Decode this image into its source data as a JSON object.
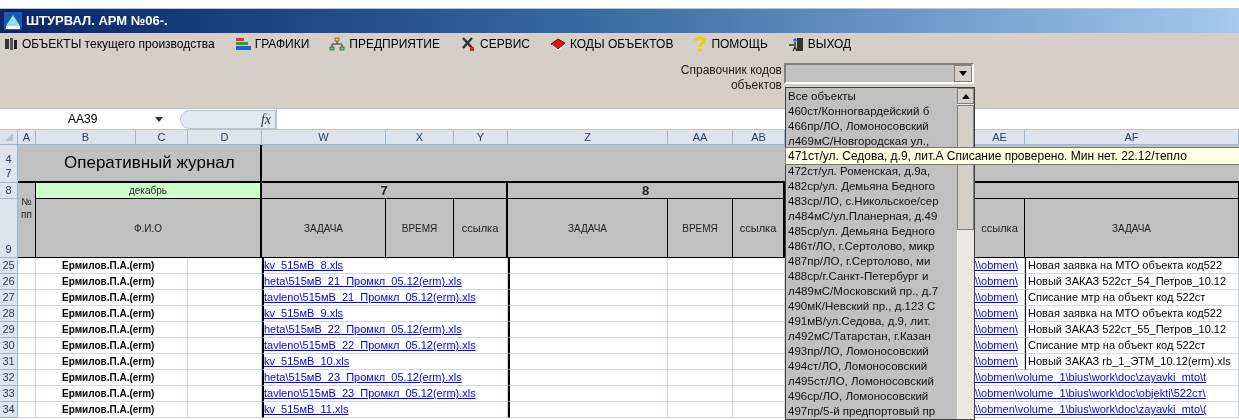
{
  "window": {
    "title": "ШТУРВАЛ. АРМ №06-."
  },
  "menu": [
    {
      "label": "ОБЪЕКТЫ текущего производства"
    },
    {
      "label": "ГРАФИКИ"
    },
    {
      "label": "ПРЕДПРИЯТИЕ"
    },
    {
      "label": "СЕРВИС"
    },
    {
      "label": "КОДЫ ОБЪЕКТОВ"
    },
    {
      "label": "ПОМОЩЬ"
    },
    {
      "label": "ВЫХОД"
    }
  ],
  "object_codes": {
    "label": "Справочник кодов объектов",
    "items": [
      {
        "kind": "item",
        "label": "Все объекты"
      },
      {
        "kind": "item",
        "label": "460ст/Конногвардейский б"
      },
      {
        "kind": "item",
        "label": "466пр/ЛО, Ломоносовский"
      },
      {
        "kind": "item",
        "label": "л469мС/Новгородская ул.,"
      },
      {
        "kind": "tooltip",
        "label": "471ст/ул. Седова, д.9, лит.А Списание проверено. Мин нет. 22.12/тепло"
      },
      {
        "kind": "item",
        "label": "472ст/ул. Роменская, д.9а,"
      },
      {
        "kind": "item",
        "label": "482ср/ул. Демьяна Бедного"
      },
      {
        "kind": "item",
        "label": "483ср/ЛО, с.Никольское/сер"
      },
      {
        "kind": "item",
        "label": "л484мС/ул.Планерная, д.49"
      },
      {
        "kind": "item",
        "label": "485ср/ул. Демьяна Бедного"
      },
      {
        "kind": "item",
        "label": "486т/ЛО, г.Сертолово, микр"
      },
      {
        "kind": "item",
        "label": "487пр/ЛО, г.Сертолово, ми"
      },
      {
        "kind": "item",
        "label": "488ср/г.Санкт-Петербург и"
      },
      {
        "kind": "item",
        "label": "л489мС/Московский пр., д.7"
      },
      {
        "kind": "item",
        "label": "490мК/Невский пр., д.123 С"
      },
      {
        "kind": "item",
        "label": "491мВ/ул.Седова, д.9, лит."
      },
      {
        "kind": "item",
        "label": "л492мС/Татарстан, г.Казан"
      },
      {
        "kind": "item",
        "label": "493пр/ЛО, Ломоносовский"
      },
      {
        "kind": "item",
        "label": "494ст/ЛО, Ломоносовский"
      },
      {
        "kind": "item",
        "label": "л495ст/ЛО, Ломоносовский"
      },
      {
        "kind": "item",
        "label": "496ср/ЛО, Ломоносовский"
      },
      {
        "kind": "item",
        "label": "497пр/5-й предпортовый пр"
      }
    ]
  },
  "formula_bar": {
    "name_box": "AA39",
    "fx": "fx"
  },
  "sheet": {
    "columns": [
      "A",
      "B",
      "C",
      "D",
      "W",
      "X",
      "Y",
      "Z",
      "AA",
      "AB",
      "AE",
      "AF"
    ],
    "title_rows": [
      "4",
      "7"
    ],
    "title": "Оперативный журнал",
    "header_rows": [
      "8",
      "9"
    ],
    "num_header": "№ пп",
    "month": "декабрь",
    "name_header": "Ф.И.О",
    "days": [
      {
        "day": "7",
        "headers": [
          "ЗАДАЧА",
          "ВРЕМЯ",
          "ссылка"
        ]
      },
      {
        "day": "8",
        "headers": [
          "ЗАДАЧА",
          "ВРЕМЯ",
          "ссылка"
        ]
      }
    ],
    "extra_headers": [
      "ссылка",
      "ЗАДАЧА"
    ],
    "rows": [
      {
        "row": "25",
        "name": "Ермилов.П.А.(erm)",
        "link": "kv_515мВ_8.xls",
        "ref": "\\\\obmen\\",
        "task": "Новая заявка на МТО объекта код522"
      },
      {
        "row": "26",
        "name": "Ермилов.П.А.(erm)",
        "link": "heta\\515мВ_21_Промкл_05.12(erm).xls",
        "ref": "\\\\obmen\\",
        "task": "Новый ЗАКАЗ 522ст_54_Петров_10.12"
      },
      {
        "row": "27",
        "name": "Ермилов.П.А.(erm)",
        "link": "tavleno\\515мВ_21_Промкл_05.12(erm).xls",
        "ref": "\\\\obmen\\",
        "task": "Списание мтр на объект код 522ст"
      },
      {
        "row": "28",
        "name": "Ермилов.П.А.(erm)",
        "link": "kv_515мВ_9.xls",
        "ref": "\\\\obmen\\",
        "task": "Новая заявка на МТО объекта код522"
      },
      {
        "row": "29",
        "name": "Ермилов.П.А.(erm)",
        "link": "heta\\515мВ_22_Промкл_05.12(erm).xls",
        "ref": "\\\\obmen\\",
        "task": "Новый ЗАКАЗ 522ст_55_Петров_10.12"
      },
      {
        "row": "30",
        "name": "Ермилов.П.А.(erm)",
        "link": "tavleno\\515мВ_22_Промкл_05.12(erm).xls",
        "ref": "\\\\obmen\\",
        "task": "Списание мтр на объект код 522ст"
      },
      {
        "row": "31",
        "name": "Ермилов.П.А.(erm)",
        "link": "kv_515мВ_10.xls",
        "ref": "\\\\obmen\\",
        "task": "Новый ЗАКАЗ rb_1_ЭТМ_10.12(erm).xls"
      },
      {
        "row": "32",
        "name": "Ермилов.П.А.(erm)",
        "link": "heta\\515мВ_23_Промкл_05.12(erm).xls",
        "ref": "\\\\obmen\\volume_1\\bius\\work\\doc\\zayavki_mto\\t"
      },
      {
        "row": "33",
        "name": "Ермилов.П.А.(erm)",
        "link": "tavleno\\515мВ_23_Промкл_05.12(erm).xls",
        "ref": "\\\\obmen\\volume_1\\bius\\work\\doc\\objekti\\522ст\\"
      },
      {
        "row": "34",
        "name": "Ермилов.П.А.(erm)",
        "link": "kv_515мВ_11.xls",
        "ref": "\\\\obmen\\volume_1\\bius\\work\\doc\\zayavki_mto\\("
      }
    ]
  }
}
